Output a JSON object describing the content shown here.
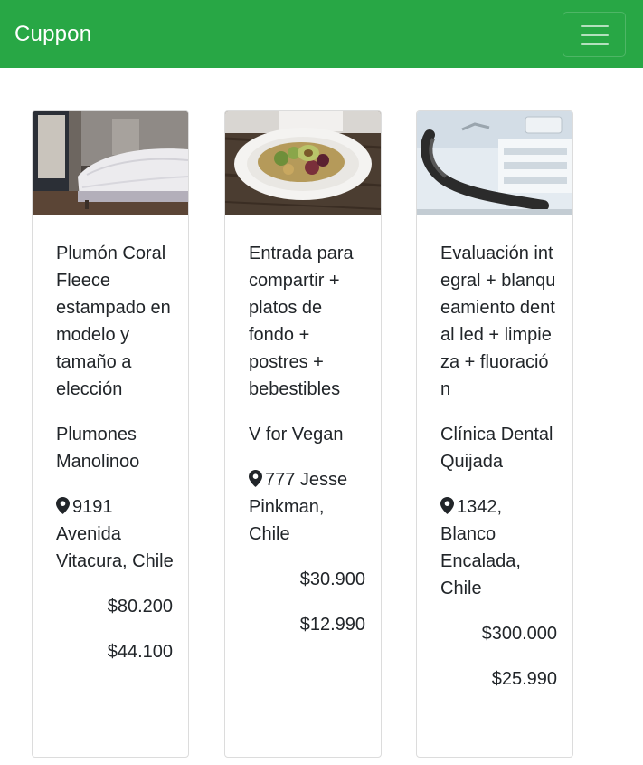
{
  "navbar": {
    "brand": "Cuppon",
    "menu_icon": "hamburger-menu-icon",
    "background_color": "#28a745"
  },
  "cards": [
    {
      "image": "bedroom-photo",
      "title": "Plumón Coral Fleece estampado en modelo y tamaño a elección",
      "company": "Plumones Manolinoo",
      "location_icon": "map-marker-icon",
      "location": "9191 Avenida Vitacura, Chile",
      "original_price": "$80.200",
      "discount_price": "$44.100"
    },
    {
      "image": "salad-plate-photo",
      "title": "Entrada para compartir + platos de fondo + postres + bebestibles",
      "company": "V for Vegan",
      "location_icon": "map-marker-icon",
      "location": "777 Jesse Pinkman, Chile",
      "original_price": "$30.900",
      "discount_price": "$12.990"
    },
    {
      "image": "dental-chair-photo",
      "title": "Evaluación integral + blanqueamiento dental led + limpieza + fluoración",
      "company": "Clínica Dental Quijada",
      "location_icon": "map-marker-icon",
      "location": "1342, Blanco Encalada, Chile",
      "original_price": "$300.000",
      "discount_price": "$25.990"
    }
  ]
}
